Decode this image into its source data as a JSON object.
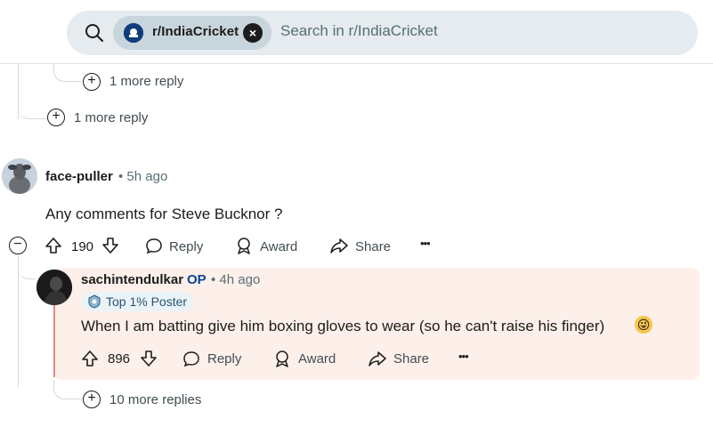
{
  "search": {
    "community": "r/IndiaCricket",
    "placeholder": "Search in r/IndiaCricket"
  },
  "thread": {
    "more_reply_nested": "1 more reply",
    "more_reply": "1 more reply"
  },
  "comment1": {
    "author": "face-puller",
    "time": "• 5h ago",
    "body": "Any comments for Steve Bucknor ?",
    "votes": "190",
    "reply": "Reply",
    "award": "Award",
    "share": "Share",
    "more": "•••"
  },
  "comment2": {
    "author": "sachintendulkar",
    "op_badge": "OP",
    "time": "• 4h ago",
    "flair": "Top 1% Poster",
    "body": "When I am batting give him boxing gloves to wear (so he can't raise his finger)",
    "emoji": "😜",
    "votes": "896",
    "reply": "Reply",
    "award": "Award",
    "share": "Share",
    "more": "•••",
    "more_replies": "10 more replies"
  },
  "colors": {
    "accent_op": "#0a449b",
    "highlight_bg": "#fdefe9",
    "search_bg": "#e5ebee",
    "chip_bg": "#c9d5dd"
  }
}
